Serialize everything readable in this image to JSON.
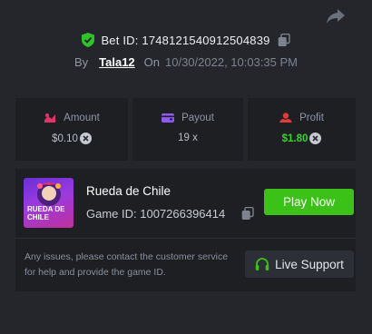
{
  "header": {
    "bet_label": "Bet ID: 1748121540912504839",
    "by_label": "By",
    "username": "Tala12",
    "on_label": "On",
    "datetime": "10/30/2022, 10:03:35 PM",
    "icons": {
      "share": "share-icon",
      "verified": "shield-check-icon",
      "copy": "copy-icon"
    }
  },
  "stats": [
    {
      "label": "Amount",
      "value": "$0.10",
      "icon": "amount-icon",
      "coin": true
    },
    {
      "label": "Payout",
      "value": "19 x",
      "icon": "wallet-icon",
      "coin": false
    },
    {
      "label": "Profit",
      "value": "$1.80",
      "icon": "profit-icon",
      "coin": true
    }
  ],
  "game": {
    "name": "Rueda de Chile",
    "id_label": "Game ID: 1007266396414",
    "thumb_text_line1": "RUEDA DE",
    "thumb_text_line2": "CHILE",
    "play_label": "Play Now"
  },
  "support": {
    "message": "Any issues, please contact the customer service for help and provide the game ID.",
    "button_label": "Live Support"
  },
  "colors": {
    "background": "#24262b",
    "card": "#1d1f23",
    "accent_green": "#3bc117",
    "profit_green": "#39d429"
  }
}
